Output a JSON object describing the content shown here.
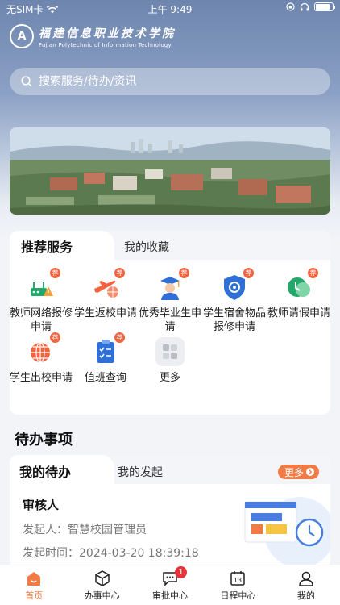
{
  "status_bar": {
    "carrier": "无SIM卡",
    "time": "上午 9:49"
  },
  "header": {
    "school_name_cn": "福建信息职业技术学院",
    "school_name_en": "Fujian Polytechnic of Information Technology"
  },
  "search": {
    "placeholder": "搜索服务/待办/资讯"
  },
  "services": {
    "tabs": [
      "推荐服务",
      "我的收藏"
    ],
    "badge": "荐",
    "items": [
      {
        "label": "教师网络报修申请",
        "icon": "network-repair-icon",
        "color": "#23a86a",
        "badge": true
      },
      {
        "label": "学生返校申请",
        "icon": "plane-return-icon",
        "color": "#f2633f",
        "badge": true
      },
      {
        "label": "优秀毕业生申请",
        "icon": "graduate-icon",
        "color": "#2f6fd6",
        "badge": true
      },
      {
        "label": "学生宿舍物品报修申请",
        "icon": "shield-repair-icon",
        "color": "#2f6fd6",
        "badge": true
      },
      {
        "label": "教师请假申请",
        "icon": "leave-request-icon",
        "color": "#23a86a",
        "badge": true
      },
      {
        "label": "学生出校申请",
        "icon": "globe-exit-icon",
        "color": "#f2633f",
        "badge": true
      },
      {
        "label": "值班查询",
        "icon": "duty-checklist-icon",
        "color": "#2f6fd6",
        "badge": true
      },
      {
        "label": "更多",
        "icon": "more-grid-icon",
        "color": "#c9ccd3",
        "badge": false
      }
    ]
  },
  "todo_section": {
    "title": "待办事项",
    "tabs": [
      "我的待办",
      "我的发起"
    ],
    "more": "更多",
    "item": {
      "title": "审核人",
      "initiator_label": "发起人：",
      "initiator": "智慧校园管理员",
      "time_label": "发起时间：",
      "time": "2024-03-20 18:39:18"
    }
  },
  "tabbar": {
    "items": [
      {
        "label": "首页",
        "icon": "home-icon",
        "active": true
      },
      {
        "label": "办事中心",
        "icon": "cube-icon",
        "active": false
      },
      {
        "label": "审批中心",
        "icon": "chat-bubble-icon",
        "active": false,
        "badge": "1"
      },
      {
        "label": "日程中心",
        "icon": "calendar-icon",
        "active": false,
        "date": "13"
      },
      {
        "label": "我的",
        "icon": "user-icon",
        "active": false
      }
    ]
  },
  "colors": {
    "accent": "#f07b45",
    "badge": "#f2633f",
    "header_blue": "#6e85ae"
  }
}
